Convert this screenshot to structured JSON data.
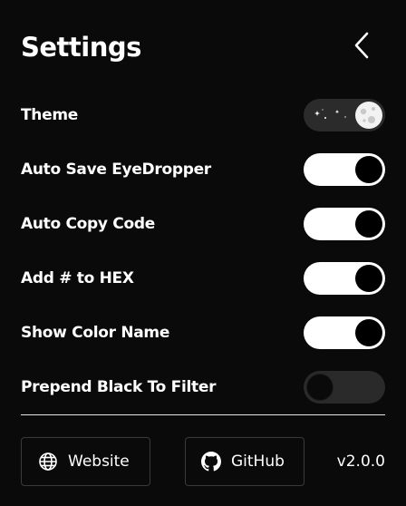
{
  "header": {
    "title": "Settings",
    "back_icon": "chevron-left-icon"
  },
  "settings": {
    "items": [
      {
        "label": "Theme",
        "state": "dark",
        "icon": "moon-icon"
      },
      {
        "label": "Auto Save EyeDropper",
        "state": "on"
      },
      {
        "label": "Auto Copy Code",
        "state": "on"
      },
      {
        "label": "Add # to HEX",
        "state": "on"
      },
      {
        "label": "Show Color Name",
        "state": "on"
      },
      {
        "label": "Prepend Black To Filter",
        "state": "off"
      }
    ]
  },
  "footer": {
    "website_label": "Website",
    "website_icon": "globe-icon",
    "github_label": "GitHub",
    "github_icon": "github-icon",
    "version": "v2.0.0"
  },
  "colors": {
    "background": "#0a0a0a",
    "toggle_on": "#ffffff",
    "toggle_off": "#2a2a2a",
    "text": "#ffffff"
  }
}
